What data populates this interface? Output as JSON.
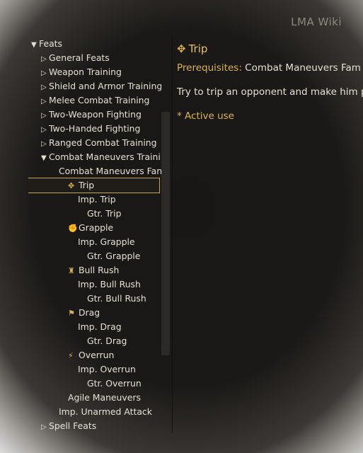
{
  "window": {
    "title": "LMA Wiki"
  },
  "tree": {
    "root": "Feats",
    "groups": [
      "General Feats",
      "Weapon Training",
      "Shield and Armor Training",
      "Melee Combat Training",
      "Two-Weapon Fighting",
      "Two-Handed Fighting",
      "Ranged Combat Training"
    ],
    "open_group": "Combat Maneuvers Traini",
    "cm_family": "Combat Maneuvers Fan",
    "trip": "Trip",
    "imp_trip": "Imp. Trip",
    "gtr_trip": "Gtr. Trip",
    "grapple": "Grapple",
    "imp_grapple": "Imp. Grapple",
    "gtr_grapple": "Gtr. Grapple",
    "bull_rush": "Bull Rush",
    "imp_bull_rush": "Imp. Bull Rush",
    "gtr_bull_rush": "Gtr. Bull Rush",
    "drag": "Drag",
    "imp_drag": "Imp. Drag",
    "gtr_drag": "Gtr. Drag",
    "overrun": "Overrun",
    "imp_overrun": "Imp. Overrun",
    "gtr_overrun": "Gtr. Overrun",
    "agile_maneuvers": "Agile Maneuvers",
    "imp_unarmed": "Imp. Unarmed Attack",
    "spell_feats": "Spell Feats"
  },
  "details": {
    "title": "Trip",
    "prereq_label": "Prerequisites:",
    "prereq_value": "Combat Maneuvers Fam",
    "description": "Try to trip an opponent and make him p",
    "note": "* Active use"
  },
  "icons": {
    "expanded": "triangle-down",
    "collapsed": "triangle-right-outline",
    "trip": "trip-icon",
    "grapple": "grapple-icon",
    "bull_rush": "bull-rush-icon",
    "drag": "drag-icon",
    "overrun": "overrun-icon"
  },
  "colors": {
    "accent": "#d8b255",
    "text": "#e5e1d8",
    "background": "#1b1917",
    "selection_border": "#c7a55a"
  }
}
